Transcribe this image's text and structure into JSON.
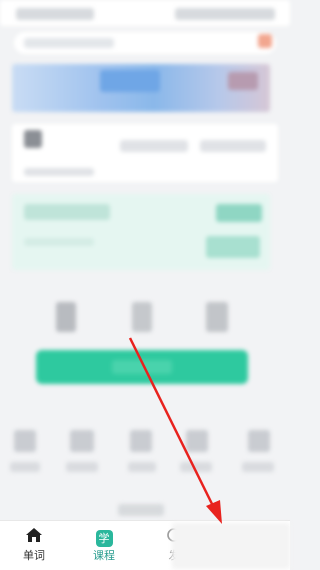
{
  "nav": {
    "items": [
      {
        "label": "单词",
        "icon": "home-icon"
      },
      {
        "label": "课程",
        "icon": "course-icon",
        "badge": "学"
      },
      {
        "label": "发",
        "icon": "discover-icon"
      }
    ]
  },
  "colors": {
    "accent_green": "#2ec99f",
    "annotation_red": "#e8221e",
    "nav_active": "#2a9d8f"
  }
}
